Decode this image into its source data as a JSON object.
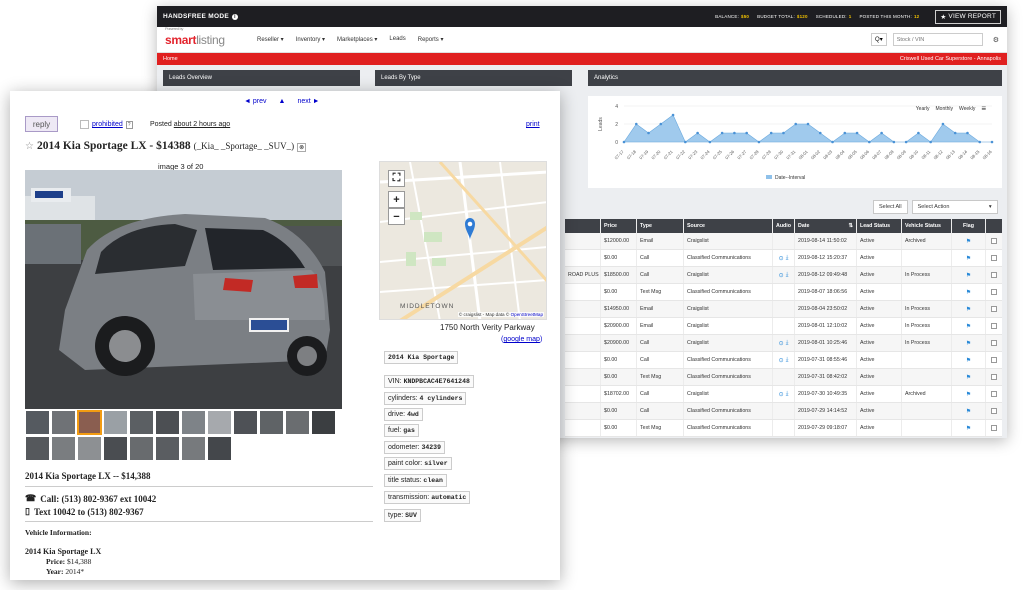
{
  "dashboard": {
    "topbar": {
      "mode": "HANDSFREE MODE",
      "stats": [
        {
          "label": "BALANCE:",
          "value": "$50"
        },
        {
          "label": "BUDGET TOTAL:",
          "value": "$120"
        },
        {
          "label": "SCHEDULED:",
          "value": "1"
        },
        {
          "label": "POSTED THIS MONTH:",
          "value": "12"
        }
      ],
      "report_button": "VIEW REPORT"
    },
    "logo": {
      "sub": "Powered by",
      "brand": "smart",
      "brand_light": "listing"
    },
    "nav": [
      "Reseller ▾",
      "Inventory ▾",
      "Marketplaces ▾",
      "Leads",
      "Reports ▾"
    ],
    "search": {
      "dropdown": "Q▾",
      "placeholder": "Stock / VIN"
    },
    "breadcrumb": {
      "home": "Home",
      "dealer": "Criswell Used Car Superstore - Annapolis"
    },
    "panels": {
      "overview": "Leads Overview",
      "by_type": "Leads By Type",
      "analytics": "Analytics"
    },
    "chart_toggles": [
      "Yearly",
      "Monthly",
      "Weekly"
    ],
    "table_controls": {
      "select_all": "Select All",
      "select_action": "Select Action"
    },
    "table": {
      "headers": [
        "",
        "Price",
        "Type",
        "Source",
        "Audio",
        "Date",
        "Lead Status",
        "Vehicle Status",
        "Flag",
        ""
      ],
      "rows": [
        {
          "name": "",
          "price": "$12000.00",
          "type": "Email",
          "source": "Craigslist",
          "audio": false,
          "date": "2019-08-14 11:50:02",
          "status": "Active",
          "vstatus": "Archived"
        },
        {
          "name": "",
          "price": "$0.00",
          "type": "Call",
          "source": "Classified Communications",
          "audio": true,
          "date": "2019-08-12 15:20:37",
          "status": "Active",
          "vstatus": ""
        },
        {
          "name": "ROAD PLUS",
          "price": "$18500.00",
          "type": "Call",
          "source": "Craigslist",
          "audio": true,
          "date": "2019-08-12 09:49:48",
          "status": "Active",
          "vstatus": "In Process"
        },
        {
          "name": "",
          "price": "$0.00",
          "type": "Text Msg",
          "source": "Classified Communications",
          "audio": false,
          "date": "2019-08-07 18:06:56",
          "status": "Active",
          "vstatus": ""
        },
        {
          "name": "",
          "price": "$14950.00",
          "type": "Email",
          "source": "Craigslist",
          "audio": false,
          "date": "2019-08-04 23:50:02",
          "status": "Active",
          "vstatus": "In Process"
        },
        {
          "name": "",
          "price": "$20900.00",
          "type": "Email",
          "source": "Craigslist",
          "audio": false,
          "date": "2019-08-01 12:10:02",
          "status": "Active",
          "vstatus": "In Process"
        },
        {
          "name": "",
          "price": "$20900.00",
          "type": "Call",
          "source": "Craigslist",
          "audio": true,
          "date": "2019-08-01 10:25:46",
          "status": "Active",
          "vstatus": "In Process"
        },
        {
          "name": "",
          "price": "$0.00",
          "type": "Call",
          "source": "Classified Communications",
          "audio": true,
          "date": "2019-07-31 08:55:46",
          "status": "Active",
          "vstatus": ""
        },
        {
          "name": "",
          "price": "$0.00",
          "type": "Text Msg",
          "source": "Classified Communications",
          "audio": false,
          "date": "2019-07-31 08:42:02",
          "status": "Active",
          "vstatus": ""
        },
        {
          "name": "",
          "price": "$18702.00",
          "type": "Call",
          "source": "Craigslist",
          "audio": true,
          "date": "2019-07-30 10:49:35",
          "status": "Active",
          "vstatus": "Archived"
        },
        {
          "name": "",
          "price": "$0.00",
          "type": "Call",
          "source": "Classified Communications",
          "audio": false,
          "date": "2019-07-29 14:14:52",
          "status": "Active",
          "vstatus": ""
        },
        {
          "name": "",
          "price": "$0.00",
          "type": "Text Msg",
          "source": "Classified Communications",
          "audio": false,
          "date": "2019-07-29 09:18:07",
          "status": "Active",
          "vstatus": ""
        }
      ]
    }
  },
  "chart_data": {
    "type": "area",
    "title": "",
    "ylabel": "Leads",
    "xlabel": "",
    "ylim": [
      0,
      4
    ],
    "yticks": [
      0,
      2,
      4
    ],
    "legend": "bottom-center",
    "grid": true,
    "color": "#8fc1ea",
    "series": [
      {
        "name": "Date--Interval",
        "x": [
          "07-17",
          "07-18",
          "07-19",
          "07-20",
          "07-21",
          "07-22",
          "07-23",
          "07-24",
          "07-25",
          "07-26",
          "07-27",
          "07-28",
          "07-29",
          "07-30",
          "07-31",
          "08-01",
          "08-02",
          "08-03",
          "08-04",
          "08-05",
          "08-06",
          "08-07",
          "08-08",
          "08-09",
          "08-10",
          "08-11",
          "08-12",
          "08-13",
          "08-14",
          "08-15",
          "08-16"
        ],
        "values": [
          0,
          2,
          1,
          2,
          3,
          0,
          1,
          0,
          1,
          1,
          1,
          0,
          1,
          1,
          2,
          2,
          1,
          0,
          1,
          1,
          0,
          1,
          0,
          0,
          1,
          0,
          2,
          1,
          1,
          0,
          0
        ]
      }
    ]
  },
  "listing": {
    "nav": {
      "prev": "◄ prev",
      "up": "▲",
      "next": "next ►"
    },
    "reply": "reply",
    "prohibited": "prohibited",
    "prohibited_q": "?",
    "posted_label": "Posted",
    "posted_ago": "about 2 hours ago",
    "print": "print",
    "title_main": "2014 Kia Sportage LX - $14388",
    "title_sub": "(_Kia_ _Sportage_ _SUV_)",
    "image_count": "image 3 of 20",
    "map": {
      "neighborhood": "MIDDLETOWN",
      "attribution_prefix": "© craigslist - Map data ©",
      "attribution_link": "OpenStreetMap",
      "address": "1750 North Verity Parkway",
      "google_link": "google map"
    },
    "attrs": [
      {
        "label": "",
        "value": "2014 Kia Sportage"
      },
      {
        "label": "VIN:",
        "value": "KNDPBCAC4E7641248"
      },
      {
        "label": "cylinders:",
        "value": "4 cylinders"
      },
      {
        "label": "drive:",
        "value": "4wd"
      },
      {
        "label": "fuel:",
        "value": "gas"
      },
      {
        "label": "odometer:",
        "value": "34239"
      },
      {
        "label": "paint color:",
        "value": "silver"
      },
      {
        "label": "title status:",
        "value": "clean"
      },
      {
        "label": "transmission:",
        "value": "automatic"
      },
      {
        "label": "type:",
        "value": "SUV"
      }
    ],
    "body": {
      "section_title": "2014 Kia Sportage LX -- $14,388",
      "call": "Call: (513) 802-9367 ext 10042",
      "text": "Text 10042 to (513) 802-9367",
      "vi_title": "Vehicle Information:",
      "vi_name": "2014 Kia Sportage LX",
      "price_label": "Price:",
      "price_value": "$14,388",
      "year_label": "Year:",
      "year_value": "2014*"
    }
  }
}
